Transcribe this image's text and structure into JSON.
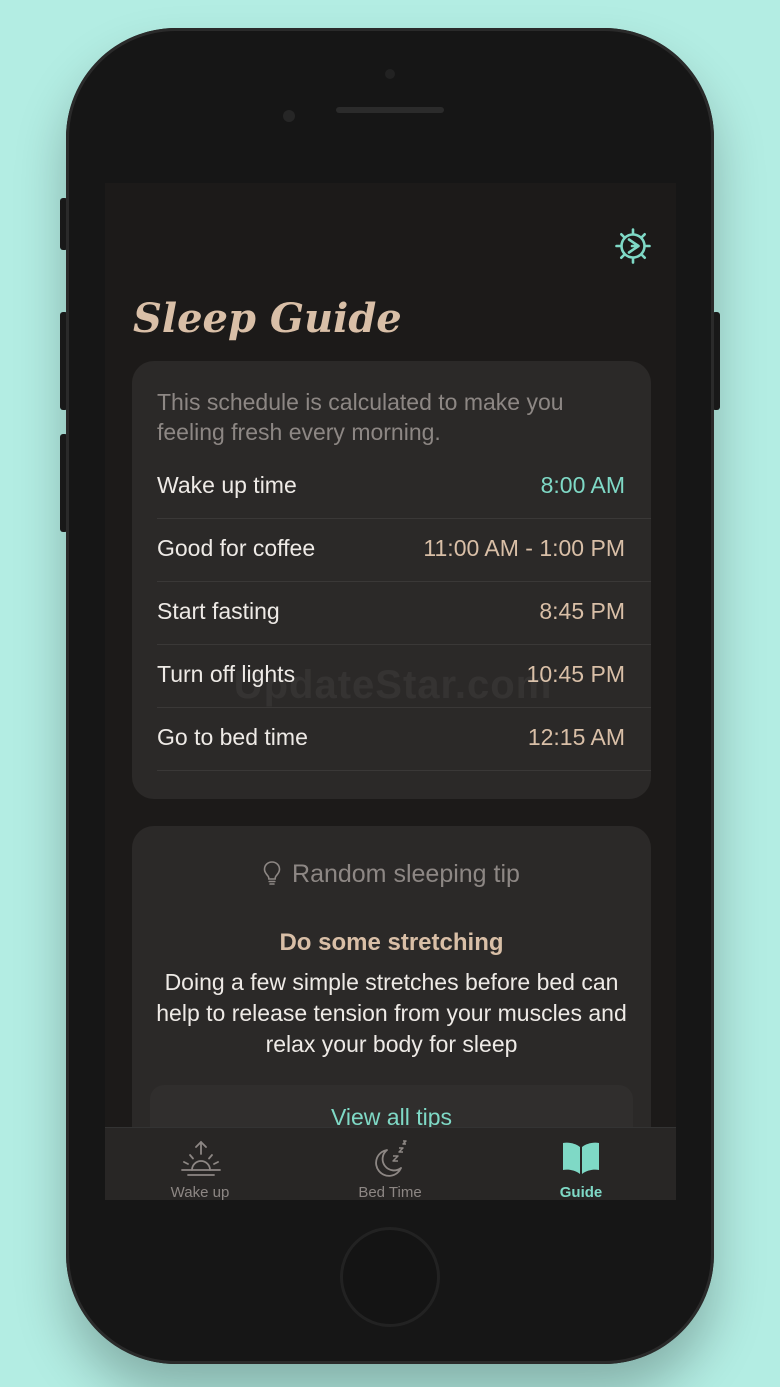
{
  "app": {
    "title": "Sleep Guide",
    "watermark": "UpdateStar.com"
  },
  "colors": {
    "background": "#b3ede3",
    "screen": "#1c1a19",
    "card": "#2b2928",
    "accent": "#7fd9c6",
    "tan": "#d9bfa7",
    "muted": "#8d8784"
  },
  "icons": {
    "settings": "gear-icon",
    "tip": "lightbulb-icon",
    "wake_up": "sunrise-icon",
    "bed_time": "moon-zzz-icon",
    "guide": "book-icon"
  },
  "schedule": {
    "intro": "This schedule is calculated to make you feeling fresh every morning.",
    "rows": [
      {
        "label": "Wake up time",
        "value": "8:00 AM"
      },
      {
        "label": "Good for coffee",
        "value": "11:00 AM - 1:00 PM"
      },
      {
        "label": "Start fasting",
        "value": "8:45 PM"
      },
      {
        "label": "Turn off lights",
        "value": "10:45 PM"
      },
      {
        "label": "Go to bed time",
        "value": "12:15 AM"
      }
    ]
  },
  "tip": {
    "heading": "Random sleeping tip",
    "title": "Do some stretching",
    "body": "Doing a few simple stretches before bed can help to release tension from your muscles and relax your body for sleep",
    "button": "View all tips"
  },
  "tabs": [
    {
      "label": "Wake up"
    },
    {
      "label": "Bed Time"
    },
    {
      "label": "Guide",
      "active": true
    }
  ]
}
